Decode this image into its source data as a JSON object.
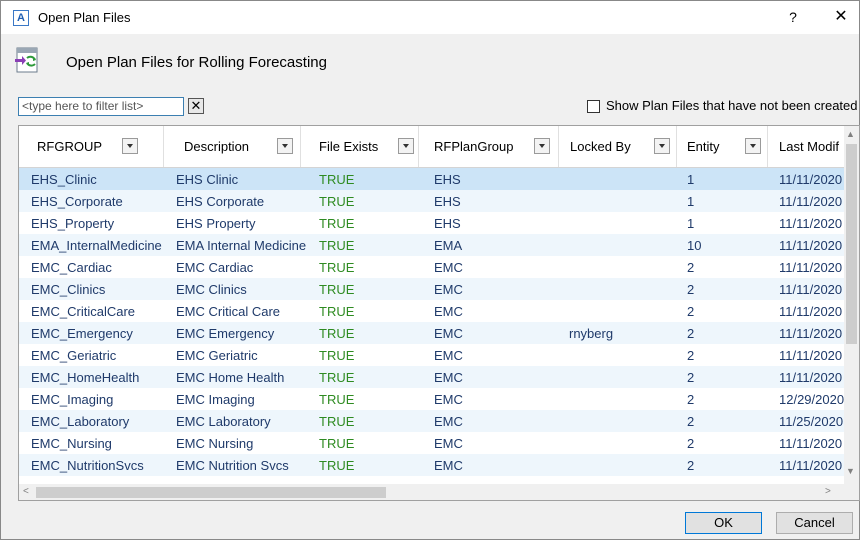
{
  "window": {
    "app_icon": "A",
    "title": "Open Plan Files",
    "help": "?",
    "close": "✕"
  },
  "header": {
    "title": "Open Plan Files for Rolling Forecasting",
    "icon": "refresh-files-icon"
  },
  "filter": {
    "placeholder": "<type here to filter list>",
    "clear": "✕"
  },
  "show_option": {
    "label": "Show Plan Files that have not been created",
    "checked": false
  },
  "columns": [
    "RFGROUP",
    "Description",
    "File Exists",
    "RFPlanGroup",
    "Locked By",
    "Entity",
    "Last Modif"
  ],
  "rows": [
    [
      "EHS_Clinic",
      "EHS Clinic",
      "TRUE",
      "EHS",
      "",
      "1",
      "11/11/2020"
    ],
    [
      "EHS_Corporate",
      "EHS Corporate",
      "TRUE",
      "EHS",
      "",
      "1",
      "11/11/2020"
    ],
    [
      "EHS_Property",
      "EHS Property",
      "TRUE",
      "EHS",
      "",
      "1",
      "11/11/2020"
    ],
    [
      "EMA_InternalMedicine",
      "EMA Internal Medicine",
      "TRUE",
      "EMA",
      "",
      "10",
      "11/11/2020"
    ],
    [
      "EMC_Cardiac",
      "EMC Cardiac",
      "TRUE",
      "EMC",
      "",
      "2",
      "11/11/2020"
    ],
    [
      "EMC_Clinics",
      "EMC Clinics",
      "TRUE",
      "EMC",
      "",
      "2",
      "11/11/2020"
    ],
    [
      "EMC_CriticalCare",
      "EMC Critical Care",
      "TRUE",
      "EMC",
      "",
      "2",
      "11/11/2020"
    ],
    [
      "EMC_Emergency",
      "EMC Emergency",
      "TRUE",
      "EMC",
      "rnyberg",
      "2",
      "11/11/2020"
    ],
    [
      "EMC_Geriatric",
      "EMC Geriatric",
      "TRUE",
      "EMC",
      "",
      "2",
      "11/11/2020"
    ],
    [
      "EMC_HomeHealth",
      "EMC Home Health",
      "TRUE",
      "EMC",
      "",
      "2",
      "11/11/2020"
    ],
    [
      "EMC_Imaging",
      "EMC Imaging",
      "TRUE",
      "EMC",
      "",
      "2",
      "12/29/2020"
    ],
    [
      "EMC_Laboratory",
      "EMC Laboratory",
      "TRUE",
      "EMC",
      "",
      "2",
      "11/25/2020"
    ],
    [
      "EMC_Nursing",
      "EMC Nursing",
      "TRUE",
      "EMC",
      "",
      "2",
      "11/11/2020"
    ],
    [
      "EMC_NutritionSvcs",
      "EMC Nutrition Svcs",
      "TRUE",
      "EMC",
      "",
      "2",
      "11/11/2020"
    ]
  ],
  "selected_row": 0,
  "buttons": {
    "ok": "OK",
    "cancel": "Cancel"
  },
  "colors": {
    "true_text": "#2e8b21",
    "cell_text": "#1f3a6a",
    "selection": "#cce4f7"
  }
}
